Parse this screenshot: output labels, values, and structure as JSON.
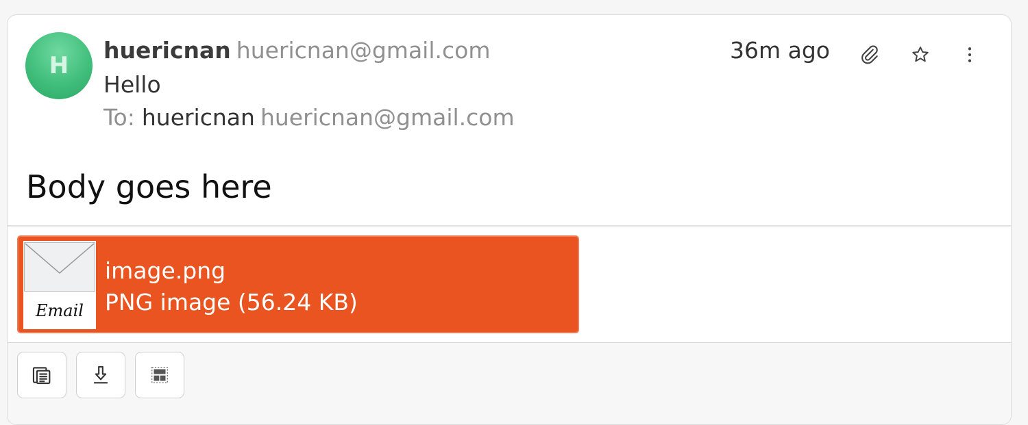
{
  "message": {
    "avatar_initial": "H",
    "sender_name": "huericnan",
    "sender_email": "huericnan@gmail.com",
    "subject": "Hello",
    "to_label": "To:",
    "recipient_name": "huericnan",
    "recipient_email": "huericnan@gmail.com",
    "timestamp": "36m ago",
    "body": "Body goes here"
  },
  "header_icons": [
    "paperclip-icon",
    "star-icon",
    "more-vertical-icon"
  ],
  "attachment": {
    "file_name": "image.png",
    "file_meta": "PNG image (56.24 KB)",
    "thumbnail_label": "Email",
    "accent_color": "#e95420"
  },
  "footer_buttons": [
    "view-source-icon",
    "download-icon",
    "layout-icon"
  ],
  "colors": {
    "avatar": "#3dbc78",
    "muted_text": "#909090",
    "attachment_bg": "#e95420"
  }
}
